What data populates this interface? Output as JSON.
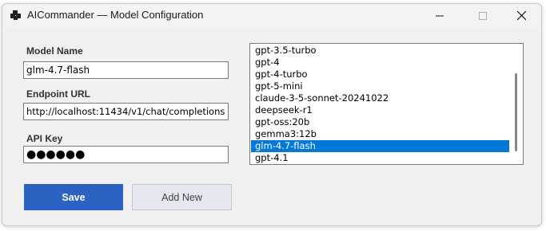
{
  "window": {
    "title": "AICommander — Model Configuration"
  },
  "form": {
    "model_name_label": "Model Name",
    "model_name_value": "glm-4.7-flash",
    "endpoint_label": "Endpoint URL",
    "endpoint_value": "http://localhost:11434/v1/chat/completions",
    "api_key_label": "API Key",
    "api_key_value": "●●●●●●"
  },
  "model_list": {
    "items": [
      {
        "label": "gpt-3.5-turbo",
        "selected": false
      },
      {
        "label": "gpt-4",
        "selected": false
      },
      {
        "label": "gpt-4-turbo",
        "selected": false
      },
      {
        "label": "gpt-5-mini",
        "selected": false
      },
      {
        "label": "claude-3-5-sonnet-20241022",
        "selected": false
      },
      {
        "label": "deepseek-r1",
        "selected": false
      },
      {
        "label": "gpt-oss:20b",
        "selected": false
      },
      {
        "label": "gemma3:12b",
        "selected": false
      },
      {
        "label": "glm-4.7-flash",
        "selected": true
      },
      {
        "label": "gpt-4.1",
        "selected": false
      }
    ],
    "selected_color": "#0078d7"
  },
  "buttons": {
    "save_label": "Save",
    "add_new_label": "Add New"
  },
  "colors": {
    "accent": "#2b63c4",
    "window_bg": "#f0f0f0"
  },
  "icons": {
    "app": "app-window-icon",
    "minimize": "minimize-icon",
    "maximize": "maximize-icon",
    "close": "close-icon"
  }
}
